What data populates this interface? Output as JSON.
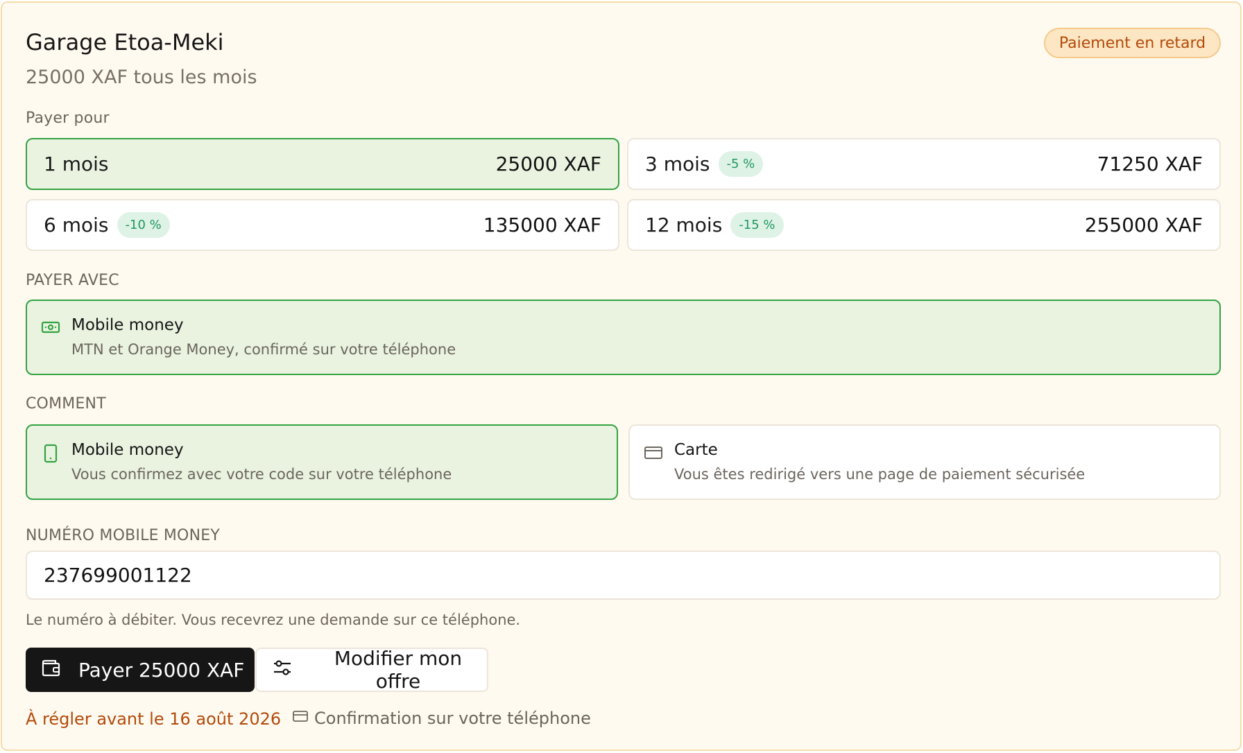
{
  "header": {
    "title": "Garage Etoa-Meki",
    "subtitle": "25000 XAF tous les mois",
    "status_badge": "Paiement en retard"
  },
  "colors": {
    "accent_green": "#33a241",
    "selected_bg": "#e9f3e0",
    "warning_orange": "#b24a0a",
    "card_bg": "#fffaf0"
  },
  "pay_for": {
    "label": "Payer pour",
    "options": [
      {
        "label": "1 mois",
        "discount": "",
        "price": "25000 XAF",
        "selected": true
      },
      {
        "label": "3 mois",
        "discount": "-5 %",
        "price": "71250 XAF",
        "selected": false
      },
      {
        "label": "6 mois",
        "discount": "-10 %",
        "price": "135000 XAF",
        "selected": false
      },
      {
        "label": "12 mois",
        "discount": "-15 %",
        "price": "255000 XAF",
        "selected": false
      }
    ]
  },
  "pay_with": {
    "label": "PAYER AVEC",
    "option": {
      "icon": "banknote-icon",
      "name": "Mobile money",
      "description": "MTN et Orange Money, confirmé sur votre téléphone",
      "selected": true
    }
  },
  "how": {
    "label": "COMMENT",
    "options": [
      {
        "icon": "smartphone-icon",
        "name": "Mobile money",
        "description": "Vous confirmez avec votre code sur votre téléphone",
        "selected": true
      },
      {
        "icon": "credit-card-icon",
        "name": "Carte",
        "description": "Vous êtes redirigé vers une page de paiement sécurisée",
        "selected": false
      }
    ]
  },
  "phone": {
    "label": "NUMÉRO MOBILE MONEY",
    "value": "237699001122",
    "hint": "Le numéro à débiter. Vous recevrez une demande sur ce téléphone."
  },
  "actions": {
    "pay_label": "Payer 25000 XAF",
    "modify_label": "Modifier mon offre"
  },
  "footer": {
    "due": "À régler avant le 16 août 2026",
    "confirmation": "Confirmation sur votre téléphone"
  }
}
